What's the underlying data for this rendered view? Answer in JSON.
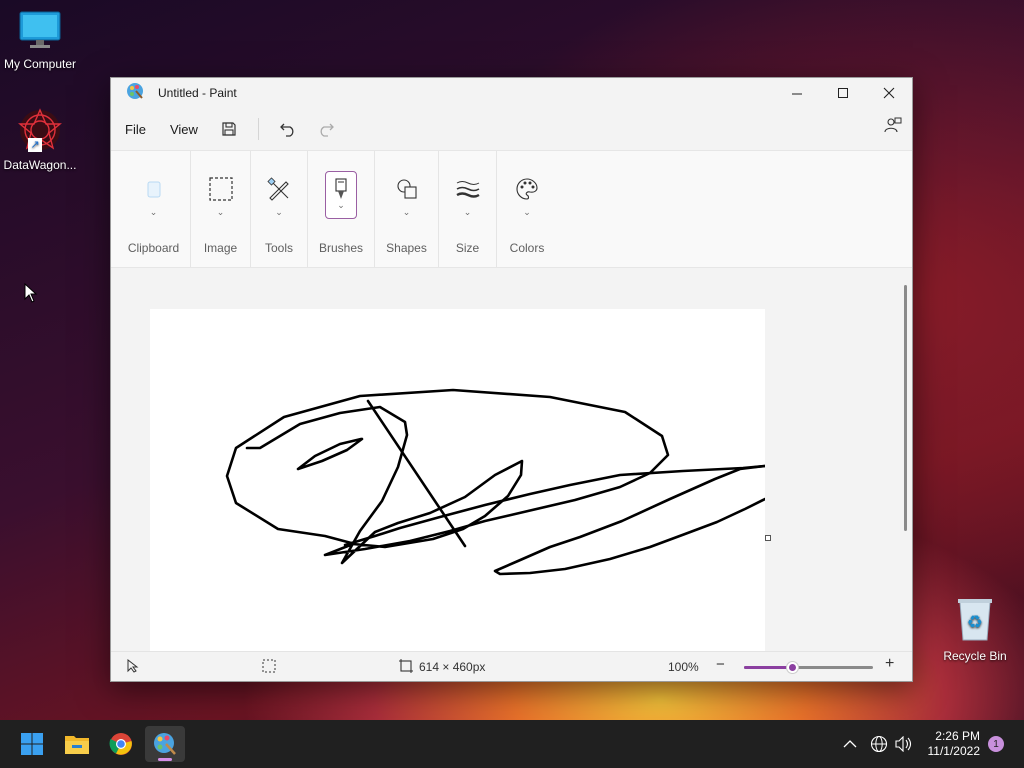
{
  "desktop": {
    "icons": [
      {
        "label": "My Computer"
      },
      {
        "label": "DataWagon..."
      },
      {
        "label": "Recycle Bin"
      }
    ]
  },
  "window": {
    "title": "Untitled - Paint",
    "menu": {
      "file": "File",
      "view": "View"
    }
  },
  "ribbon": {
    "groups": [
      {
        "label": "Clipboard"
      },
      {
        "label": "Image"
      },
      {
        "label": "Tools"
      },
      {
        "label": "Brushes"
      },
      {
        "label": "Shapes"
      },
      {
        "label": "Size"
      },
      {
        "label": "Colors"
      }
    ]
  },
  "status": {
    "dimensions": "614 × 460px",
    "zoom": "100%",
    "zoom_level": 0.38
  },
  "taskbar": {
    "time": "2:26 PM",
    "date": "11/1/2022",
    "notifications": "1"
  },
  "colors": {
    "accent": "#8b3fa0",
    "stroke": "#000000"
  }
}
